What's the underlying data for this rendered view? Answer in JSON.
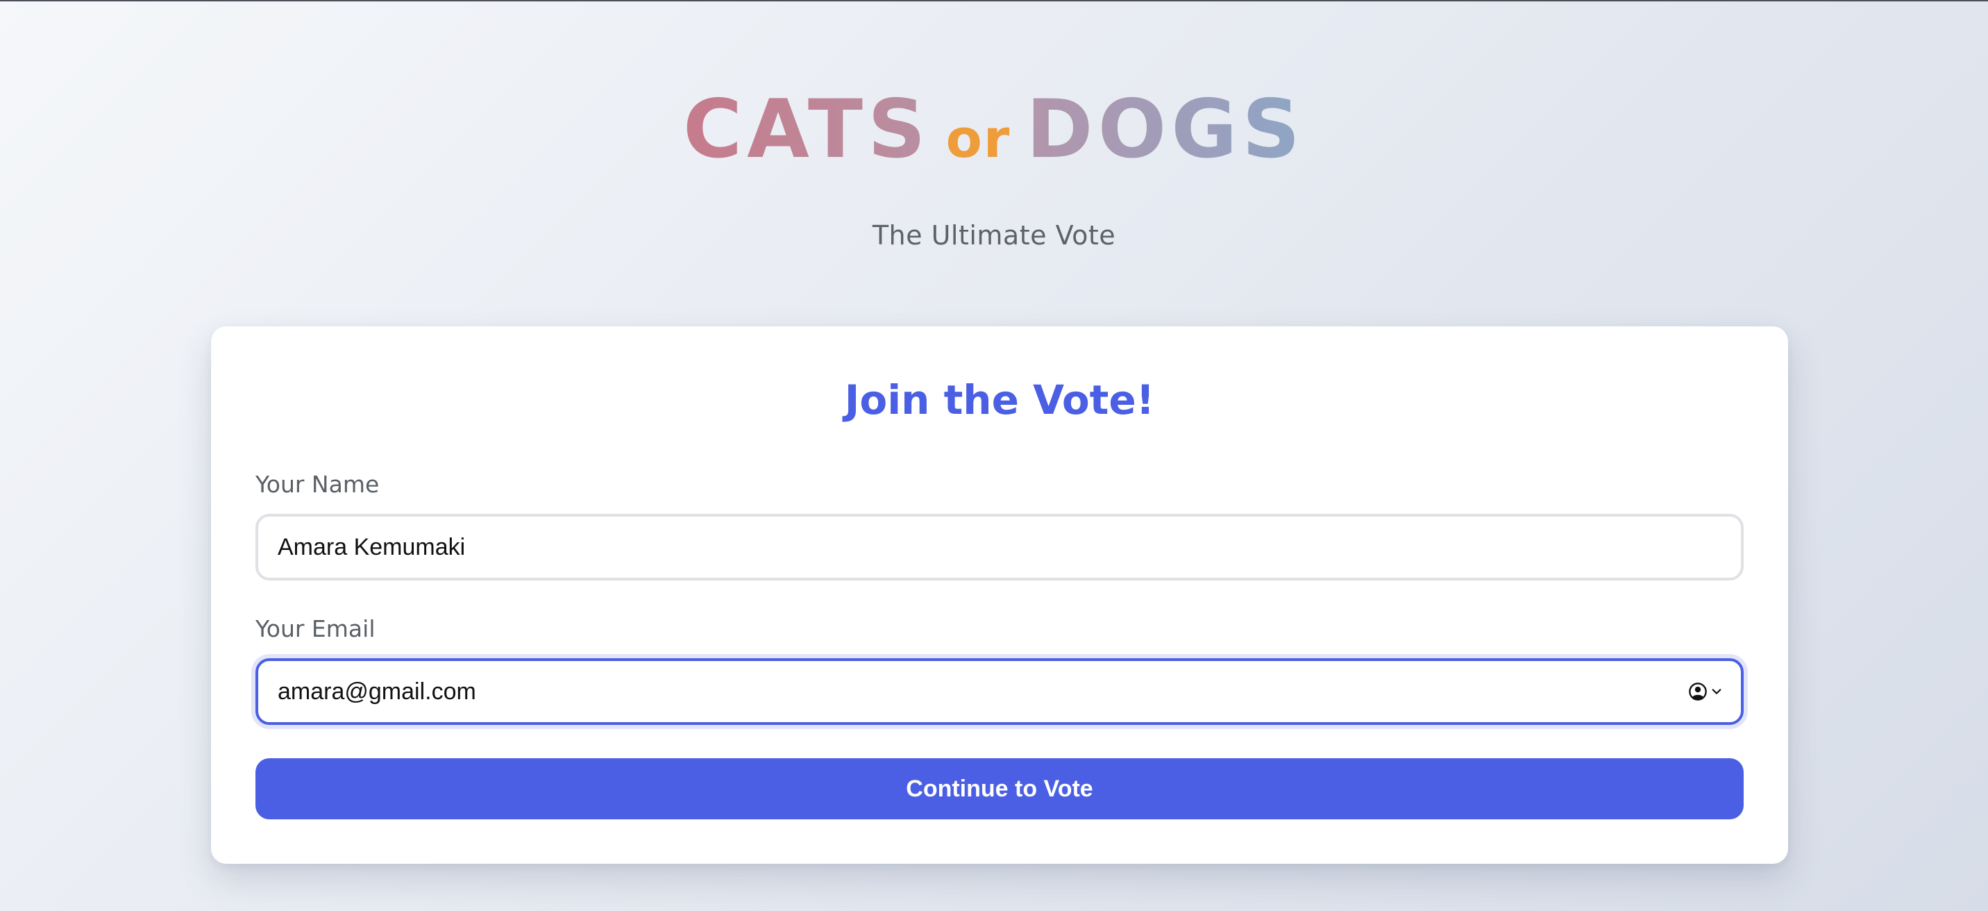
{
  "header": {
    "title_cats": "CATS",
    "title_or": "or",
    "title_dogs": "DOGS",
    "subtitle": "The Ultimate Vote"
  },
  "form": {
    "heading": "Join the Vote!",
    "name_label": "Your Name",
    "name_value": "Amara Kemumaki",
    "email_label": "Your Email",
    "email_value": "amara@gmail.com",
    "submit_label": "Continue to Vote",
    "autofill_icon": "contact-autofill-icon"
  },
  "colors": {
    "accent": "#4a5fe3",
    "cats_gradient": [
      "#c67b8b",
      "#b88fa2"
    ],
    "or": "#ef9c3a",
    "dogs_gradient": [
      "#b395ab",
      "#8ea5c6"
    ],
    "label_text": "#5b5f66"
  }
}
